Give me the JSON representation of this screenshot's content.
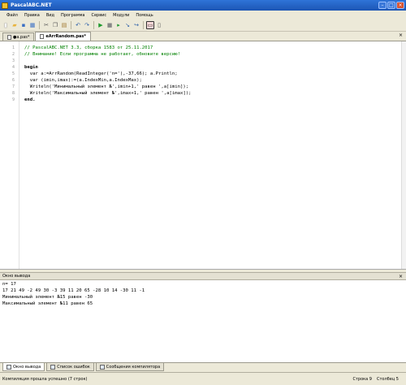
{
  "window": {
    "title": "PascalABC.NET"
  },
  "menu": [
    "Файл",
    "Правка",
    "Вид",
    "Программа",
    "Сервис",
    "Модули",
    "Помощь"
  ],
  "toolbar": {
    "icons": [
      "new-file-icon",
      "open-icon",
      "save-icon",
      "save-all-icon",
      "cut-icon",
      "copy-icon",
      "paste-icon",
      "undo-icon",
      "redo-icon",
      "run-icon",
      "stop-icon",
      "debug-icon",
      "step-into-icon",
      "step-over-icon",
      "output-window-icon",
      "settings-icon"
    ]
  },
  "tabs": [
    {
      "label": "●a.pas*"
    },
    {
      "label": "eArrRandom.pas*"
    }
  ],
  "editor": {
    "line_numbers": [
      "1",
      "2",
      "3",
      "4",
      "5",
      "6",
      "7",
      "8",
      "9"
    ],
    "lines": [
      "// PascalABC.NET 3.3, сборка 1583 от 25.11.2017",
      "// Внимание! Если программа не работает, обновите версию!",
      "",
      "begin",
      "  var a:=ArrRandom(ReadInteger('n='),-37,66); a.Println;",
      "  var (imin,imax):=(a.IndexMin,a.IndexMax);",
      "  Writeln('Минимальный элемент №',imin+1,' равен ',a[imin]);",
      "  Writeln('Максимальный элемент №',imax+1,' равен ',a[imax]);",
      "end."
    ]
  },
  "output_panel": {
    "title": "Окно вывода"
  },
  "output": {
    "lines": [
      "n= 17",
      "17 21 49 -2 49 30 -3 39 11 20 65 -28 10 14 -30 11 -1",
      "Минимальный элемент №15 равен -30",
      "Максимальный элемент №11 равен 65"
    ]
  },
  "bottom_tabs": [
    "Окно вывода",
    "Список ошибок",
    "Сообщения компилятора"
  ],
  "status": {
    "message": "Компиляция прошла успешно (7 строк)",
    "row": "Строка  9",
    "col": "Столбец  5"
  }
}
